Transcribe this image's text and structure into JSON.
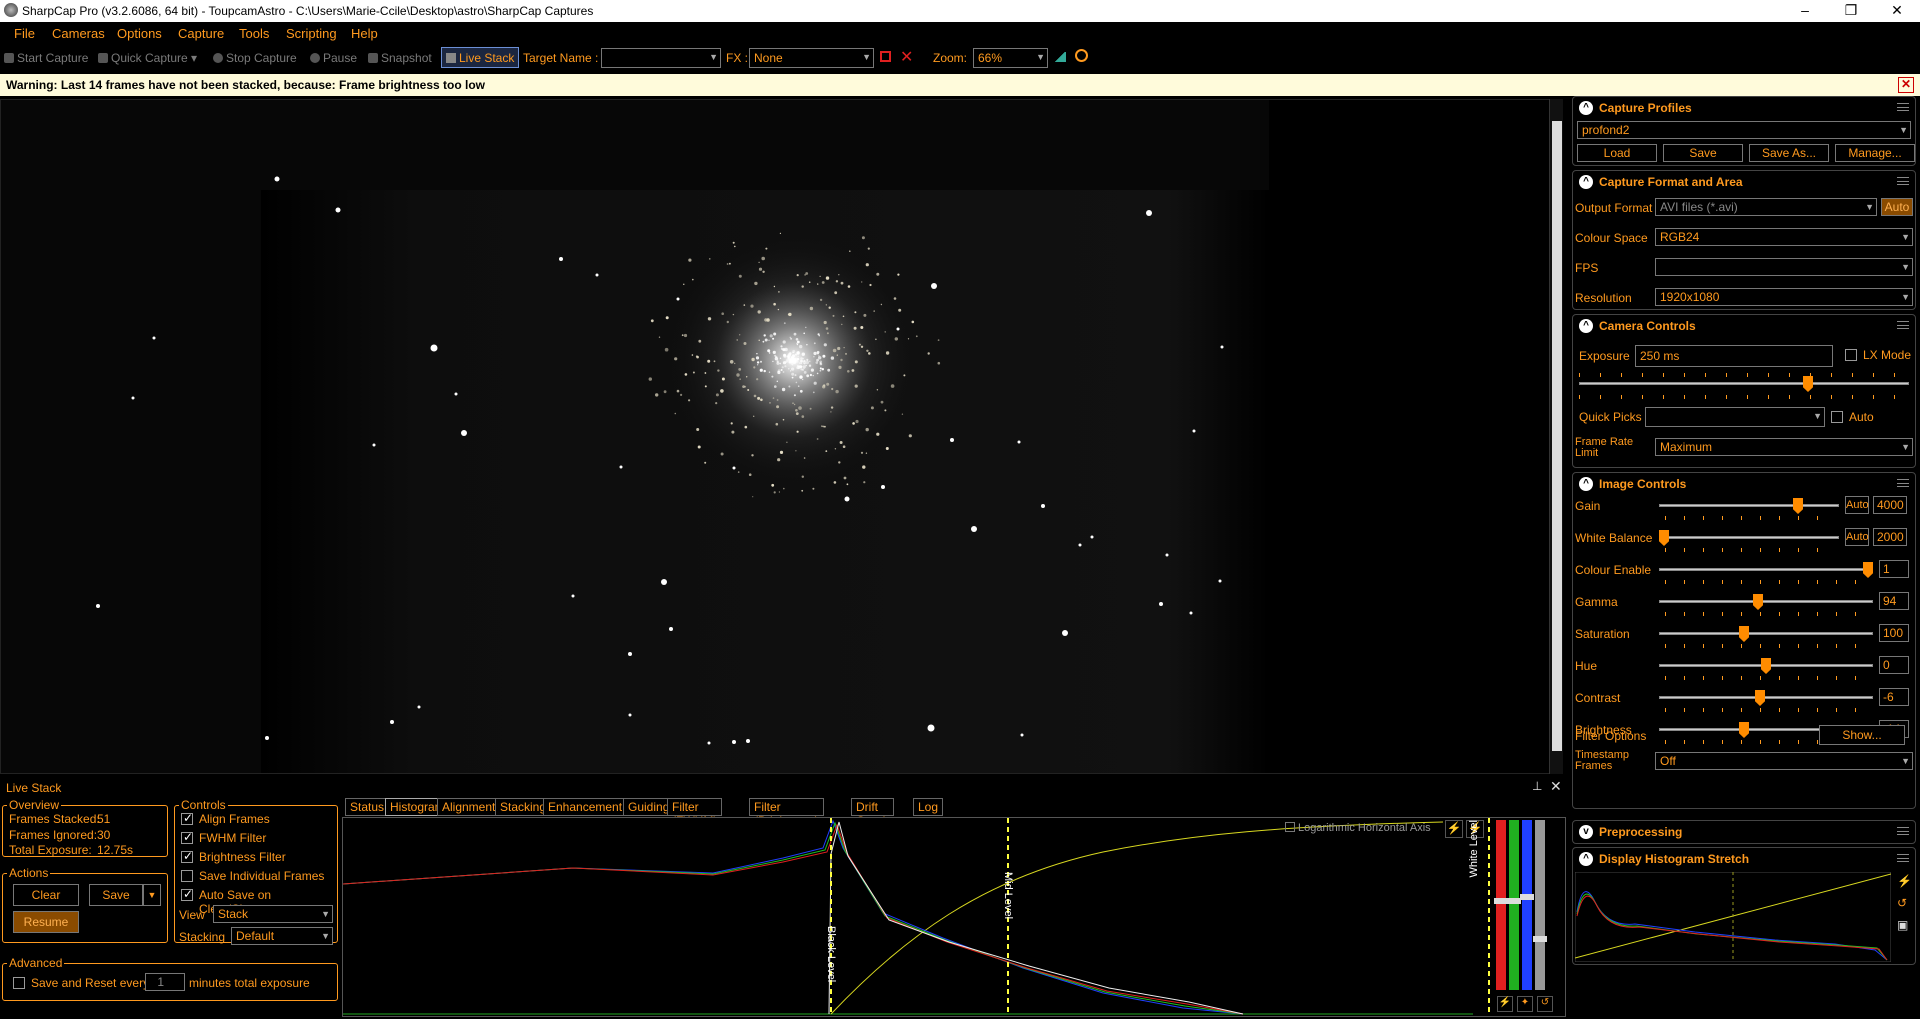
{
  "title": "SharpCap Pro (v3.2.6086, 64 bit) - ToupcamAstro - C:\\Users\\Marie-Ccile\\Desktop\\astro\\SharpCap Captures",
  "window_controls": {
    "minimize": "–",
    "restore": "❐",
    "close": "✕"
  },
  "menu": [
    "File",
    "Cameras",
    "Options",
    "Capture",
    "Tools",
    "Scripting",
    "Help"
  ],
  "toolbar": {
    "start_capture": "Start Capture",
    "quick_capture": "Quick Capture",
    "stop_capture": "Stop Capture",
    "pause": "Pause",
    "snapshot": "Snapshot",
    "live_stack": "Live Stack",
    "target_name_label": "Target Name :",
    "target_name_value": "",
    "fx_label": "FX :",
    "fx_value": "None",
    "zoom_label": "Zoom:",
    "zoom_value": "66%"
  },
  "warning": "Warning: Last 14 frames have not been stacked, because: Frame brightness too low",
  "right_panel": {
    "capture_profiles": {
      "title": "Capture Profiles",
      "profile": "profond2",
      "load": "Load",
      "save": "Save",
      "save_as": "Save As...",
      "manage": "Manage..."
    },
    "capture_format": {
      "title": "Capture Format and Area",
      "output_format_label": "Output Format",
      "output_format_value": "AVI files (*.avi)",
      "auto": "Auto",
      "colour_space_label": "Colour Space",
      "colour_space_value": "RGB24",
      "fps_label": "FPS",
      "fps_value": "",
      "resolution_label": "Resolution",
      "resolution_value": "1920x1080"
    },
    "camera_controls": {
      "title": "Camera Controls",
      "exposure_label": "Exposure",
      "exposure_value": "250 ms",
      "lx_mode": "LX Mode",
      "exposure_slider": 0.7,
      "quick_picks_label": "Quick Picks",
      "quick_picks_value": "",
      "auto": "Auto",
      "frame_rate_label": "Frame Rate Limit",
      "frame_rate_value": "Maximum"
    },
    "image_controls": {
      "title": "Image Controls",
      "rows": [
        {
          "label": "Gain",
          "value": "4000",
          "pos": 0.79,
          "auto": "Auto"
        },
        {
          "label": "White Balance",
          "value": "2000",
          "pos": 0.0,
          "auto": "Auto"
        },
        {
          "label": "Colour Enable",
          "value": "1",
          "pos": 1.0
        },
        {
          "label": "Gamma",
          "value": "94",
          "pos": 0.46
        },
        {
          "label": "Saturation",
          "value": "100",
          "pos": 0.39
        },
        {
          "label": "Hue",
          "value": "0",
          "pos": 0.5
        },
        {
          "label": "Contrast",
          "value": "-6",
          "pos": 0.47
        },
        {
          "label": "Brightness",
          "value": "-14",
          "pos": 0.39
        }
      ],
      "filter_options_label": "Filter Options",
      "filter_options_button": "Show...",
      "timestamp_label": "Timestamp Frames",
      "timestamp_value": "Off"
    },
    "preprocessing": {
      "title": "Preprocessing"
    },
    "histogram_stretch": {
      "title": "Display Histogram Stretch"
    }
  },
  "live_stack": {
    "title": "Live Stack",
    "overview": {
      "title": "Overview",
      "frames_stacked_label": "Frames Stacked:",
      "frames_stacked": "51",
      "frames_ignored_label": "Frames Ignored:",
      "frames_ignored": "30",
      "total_exposure_label": "Total Exposure:",
      "total_exposure": "12.75s"
    },
    "actions": {
      "title": "Actions",
      "clear": "Clear",
      "save": "Save",
      "resume": "Resume"
    },
    "controls": {
      "title": "Controls",
      "align_frames": "Align Frames",
      "fwhm_filter": "FWHM Filter",
      "brightness_filter": "Brightness Filter",
      "save_individual": "Save Individual Frames",
      "auto_save": "Auto Save on Clear/Close",
      "view_label": "View",
      "view_value": "Stack",
      "stacking_label": "Stacking",
      "stacking_value": "Default"
    },
    "advanced": {
      "title": "Advanced",
      "save_reset_label": "Save and Reset every",
      "minutes_value": "1",
      "minutes_suffix": "minutes total exposure"
    },
    "tabs": [
      "Status",
      "Histogram",
      "Alignment",
      "Stacking",
      "Enhancement",
      "Guiding",
      "Filter (FWHM)",
      "Filter (Brightness)",
      "Drift Graph",
      "Log"
    ],
    "active_tab": "Histogram",
    "histogram": {
      "log_axis_label": "Logarithmic Horizontal Axis",
      "black_level": "Black Level",
      "mid_level": "Mid Level",
      "white_level": "White Level"
    }
  }
}
